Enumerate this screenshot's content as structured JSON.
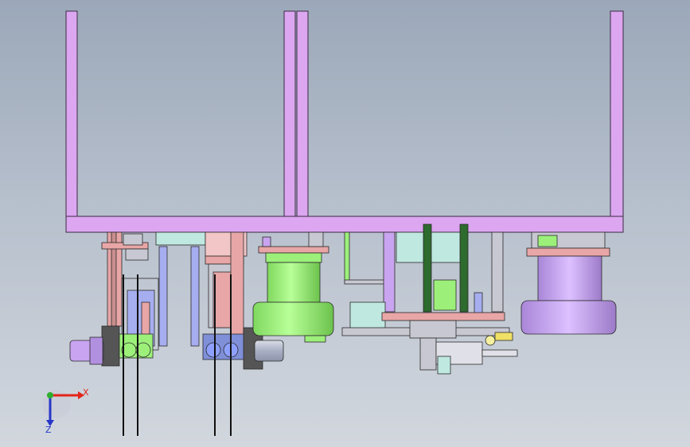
{
  "viewport": {
    "background_top": "#9ba8b9",
    "background_bottom": "#d2d7de"
  },
  "axes": {
    "x_label": "X",
    "z_label": "Z",
    "x_color": "#e3241b",
    "y_color": "#2fae2f",
    "z_color": "#2736c8"
  },
  "colors": {
    "frame": "#dca6f0",
    "frame_edge": "#3a2a44",
    "green": "#9cf07a",
    "purple": "#c9a4f0",
    "pink": "#e8a6a6",
    "blue": "#a6aef0",
    "cyan": "#bfe8e0",
    "grey": "#c8c8d2",
    "dark": "#2a2a2a"
  }
}
